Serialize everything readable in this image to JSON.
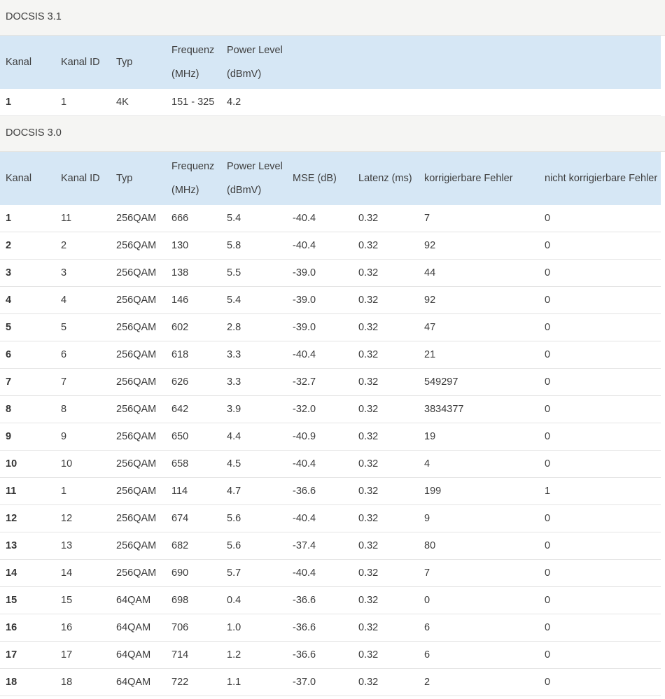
{
  "docsis31": {
    "title": "DOCSIS 3.1",
    "headers": [
      "Kanal",
      "Kanal ID",
      "Typ",
      "Frequenz",
      "(MHz)",
      "Power Level",
      "(dBmV)"
    ],
    "rows": [
      [
        "1",
        "1",
        "4K",
        "151 - 325",
        "4.2"
      ]
    ]
  },
  "docsis30": {
    "title": "DOCSIS 3.0",
    "headers": {
      "kanal": "Kanal",
      "kanal_id": "Kanal ID",
      "typ": "Typ",
      "freq_1": "Frequenz",
      "freq_2": "(MHz)",
      "power_1": "Power Level",
      "power_2": "(dBmV)",
      "mse": "MSE (dB)",
      "latenz": "Latenz (ms)",
      "korr": "korrigierbare Fehler",
      "nicht_korr": "nicht korrigierbare Fehler"
    },
    "rows": [
      [
        "1",
        "11",
        "256QAM",
        "666",
        "5.4",
        "-40.4",
        "0.32",
        "7",
        "0"
      ],
      [
        "2",
        "2",
        "256QAM",
        "130",
        "5.8",
        "-40.4",
        "0.32",
        "92",
        "0"
      ],
      [
        "3",
        "3",
        "256QAM",
        "138",
        "5.5",
        "-39.0",
        "0.32",
        "44",
        "0"
      ],
      [
        "4",
        "4",
        "256QAM",
        "146",
        "5.4",
        "-39.0",
        "0.32",
        "92",
        "0"
      ],
      [
        "5",
        "5",
        "256QAM",
        "602",
        "2.8",
        "-39.0",
        "0.32",
        "47",
        "0"
      ],
      [
        "6",
        "6",
        "256QAM",
        "618",
        "3.3",
        "-40.4",
        "0.32",
        "21",
        "0"
      ],
      [
        "7",
        "7",
        "256QAM",
        "626",
        "3.3",
        "-32.7",
        "0.32",
        "549297",
        "0"
      ],
      [
        "8",
        "8",
        "256QAM",
        "642",
        "3.9",
        "-32.0",
        "0.32",
        "3834377",
        "0"
      ],
      [
        "9",
        "9",
        "256QAM",
        "650",
        "4.4",
        "-40.9",
        "0.32",
        "19",
        "0"
      ],
      [
        "10",
        "10",
        "256QAM",
        "658",
        "4.5",
        "-40.4",
        "0.32",
        "4",
        "0"
      ],
      [
        "11",
        "1",
        "256QAM",
        "114",
        "4.7",
        "-36.6",
        "0.32",
        "199",
        "1"
      ],
      [
        "12",
        "12",
        "256QAM",
        "674",
        "5.6",
        "-40.4",
        "0.32",
        "9",
        "0"
      ],
      [
        "13",
        "13",
        "256QAM",
        "682",
        "5.6",
        "-37.4",
        "0.32",
        "80",
        "0"
      ],
      [
        "14",
        "14",
        "256QAM",
        "690",
        "5.7",
        "-40.4",
        "0.32",
        "7",
        "0"
      ],
      [
        "15",
        "15",
        "64QAM",
        "698",
        "0.4",
        "-36.6",
        "0.32",
        "0",
        "0"
      ],
      [
        "16",
        "16",
        "64QAM",
        "706",
        "1.0",
        "-36.6",
        "0.32",
        "6",
        "0"
      ],
      [
        "17",
        "17",
        "64QAM",
        "714",
        "1.2",
        "-36.6",
        "0.32",
        "6",
        "0"
      ],
      [
        "18",
        "18",
        "64QAM",
        "722",
        "1.1",
        "-37.0",
        "0.32",
        "2",
        "0"
      ]
    ]
  }
}
